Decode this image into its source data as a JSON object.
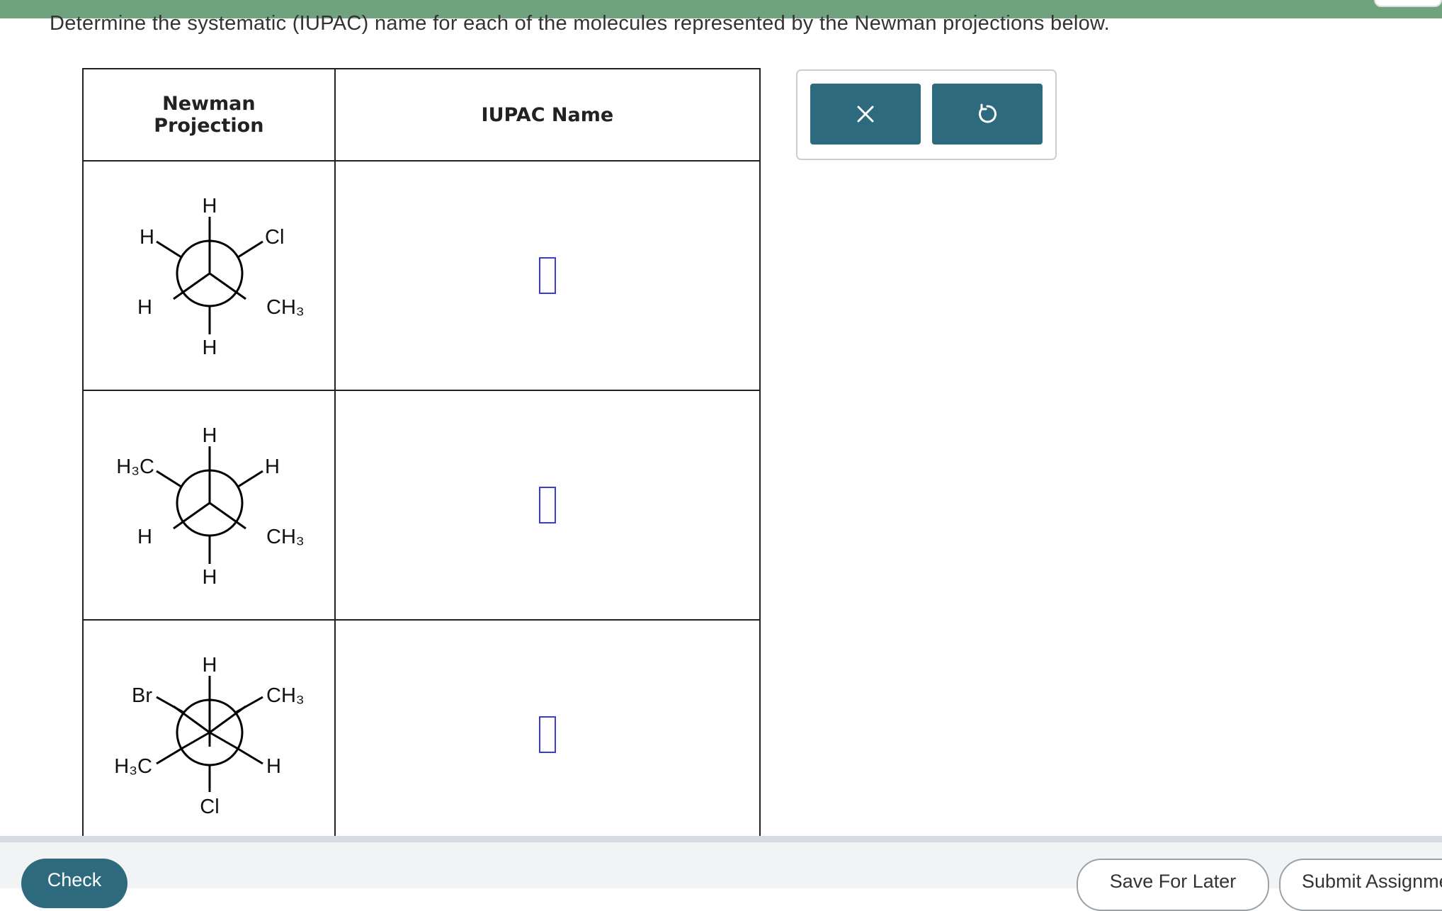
{
  "question": "Determine the systematic (IUPAC) name for each of the molecules represented by the Newman projections below.",
  "table": {
    "headers": {
      "projection": [
        "Newman",
        "Projection"
      ],
      "iupac": "IUPAC Name"
    },
    "rows": [
      {
        "front": {
          "top": "H",
          "bottom_left": "H",
          "bottom_right": "CH₃"
        },
        "back": {
          "upper_left": "H",
          "upper_right": "Cl",
          "bottom": "H"
        },
        "answer": ""
      },
      {
        "front": {
          "top": "H",
          "bottom_left": "H",
          "bottom_right": "CH₃"
        },
        "back": {
          "upper_left": "H₃C",
          "upper_right": "H",
          "bottom": "H"
        },
        "answer": ""
      },
      {
        "front": {
          "top": "H",
          "bottom": "Cl"
        },
        "back": {
          "upper_left": "Br",
          "upper_right": "CH₃",
          "lower_left": "H₃C",
          "lower_right": "H"
        },
        "answer": ""
      }
    ]
  },
  "tools": {
    "close_icon": "close-x-icon",
    "undo_icon": "undo-arrow-icon",
    "color": "#2e6a7e"
  },
  "footer": {
    "check": "Check",
    "save": "Save For Later",
    "submit": "Submit Assignment"
  }
}
